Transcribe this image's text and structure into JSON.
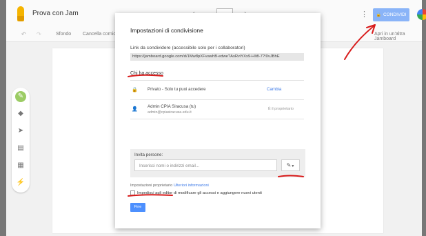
{
  "app": {
    "title": "Prova con Jam",
    "more_icon": "⋮",
    "share_label": "CONDIVIDI",
    "nav_prev": "‹",
    "nav_next": "›"
  },
  "toolbar": {
    "undo": "↶",
    "redo": "↷",
    "sfondo": "Sfondo",
    "cancella": "Cancella cornice",
    "apri": "Apri in un'altra Jamboard"
  },
  "tools": [
    "pen-icon",
    "eraser-icon",
    "select-icon",
    "sticky-note-icon",
    "image-icon",
    "laser-icon"
  ],
  "dialog": {
    "title": "Impostazioni di condivisione",
    "link_label": "Link da condividere (accessibile solo per i collaboratori)",
    "link_value": "https://jamboard.google.com/d/1Mw8pXFvawhB-edwe?AsRviYXx9-HIt8-7?!0vJBhE",
    "access_label": "Chi ha accesso",
    "access_rows": [
      {
        "icon": "lock-icon",
        "text": "Privato - Solo tu puoi accedere",
        "action": "Cambia"
      },
      {
        "icon": "person-icon",
        "name": "Admin CPIA Siracusa (tu)",
        "email": "admin@cpiasiracusa.edu.it",
        "role": "È il proprietario"
      }
    ],
    "invite": {
      "label": "Invita persone:",
      "placeholder": "Inserisci nomi o indirizzi email..."
    },
    "owner_settings": "Impostazioni proprietario",
    "owner_link": "Ulteriori informazioni",
    "checkbox_label_u": "Impedisci agli editor",
    "checkbox_label_rest": "di modificare gli accessi e aggiungere nuovi utenti",
    "done": "Fine"
  },
  "colors": {
    "share_button": "#8ab4f8",
    "annotation_red": "#d81b1b",
    "link_blue": "#3b78e7",
    "pen_tool": "#9ccc65"
  }
}
